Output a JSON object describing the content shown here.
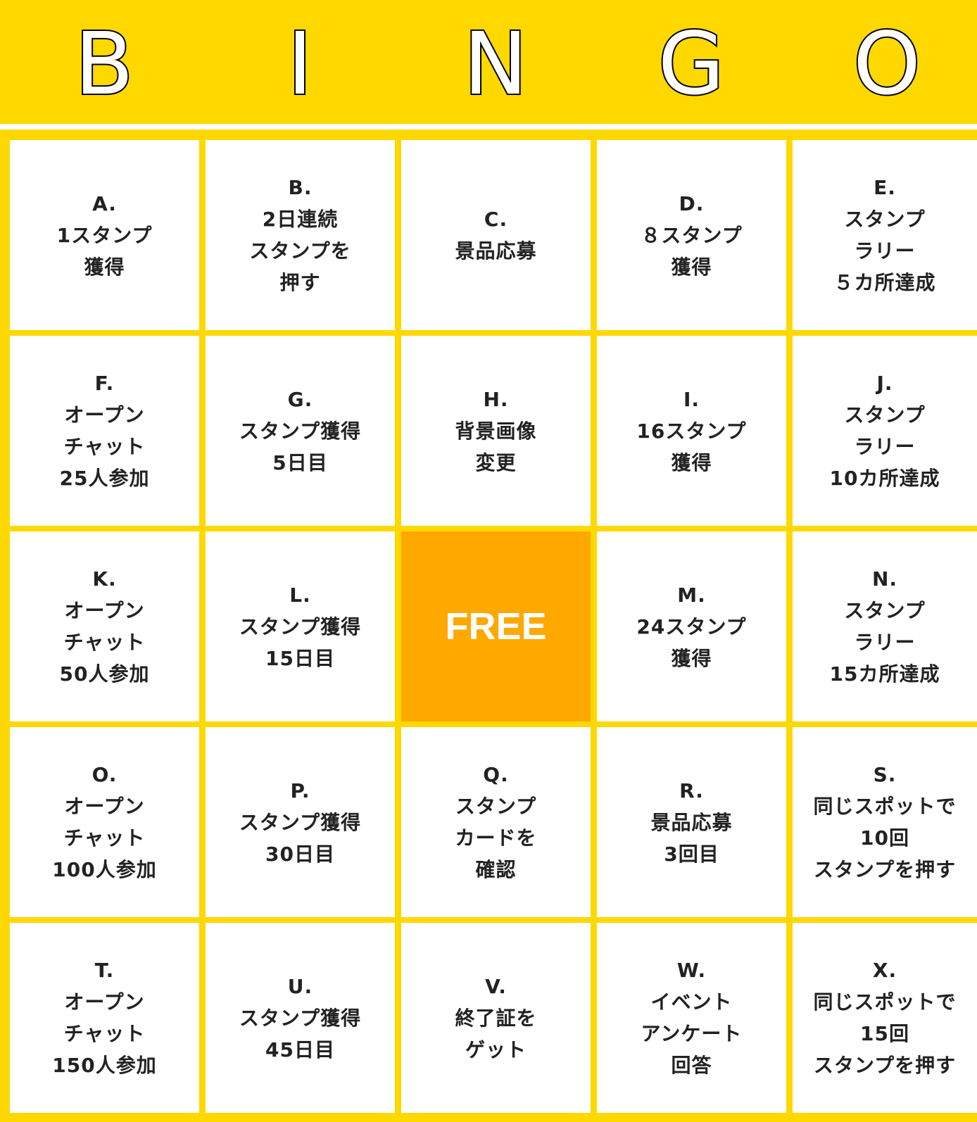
{
  "header": {
    "letters": [
      "B",
      "I",
      "N",
      "G",
      "O"
    ]
  },
  "colors": {
    "background": "#FFD800",
    "cell": "#FFFFFF",
    "free_cell": "#FFA800",
    "text": "#222222"
  },
  "board": {
    "rows": [
      [
        "A.\n1スタンプ\n獲得",
        "B.\n2日連続\nスタンプを\n押す",
        "C.\n景品応募",
        "D.\n８スタンプ\n獲得",
        "E.\nスタンプ\nラリー\n５カ所達成"
      ],
      [
        "F.\nオープン\nチャット\n25人参加",
        "G.\nスタンプ獲得\n5日目",
        "H.\n背景画像\n変更",
        "I.\n16スタンプ\n獲得",
        "J.\nスタンプ\nラリー\n10カ所達成"
      ],
      [
        "K.\nオープン\nチャット\n50人参加",
        "L.\nスタンプ獲得\n15日目",
        "FREE",
        "M.\n24スタンプ\n獲得",
        "N.\nスタンプ\nラリー\n15カ所達成"
      ],
      [
        "O.\nオープン\nチャット\n100人参加",
        "P.\nスタンプ獲得\n30日目",
        "Q.\nスタンプ\nカードを\n確認",
        "R.\n景品応募\n3回目",
        "S.\n同じスポットで\n10回\nスタンプを押す"
      ],
      [
        "T.\nオープン\nチャット\n150人参加",
        "U.\nスタンプ獲得\n45日目",
        "V.\n終了証を\nゲット",
        "W.\nイベント\nアンケート\n回答",
        "X.\n同じスポットで\n15回\nスタンプを押す"
      ]
    ]
  }
}
